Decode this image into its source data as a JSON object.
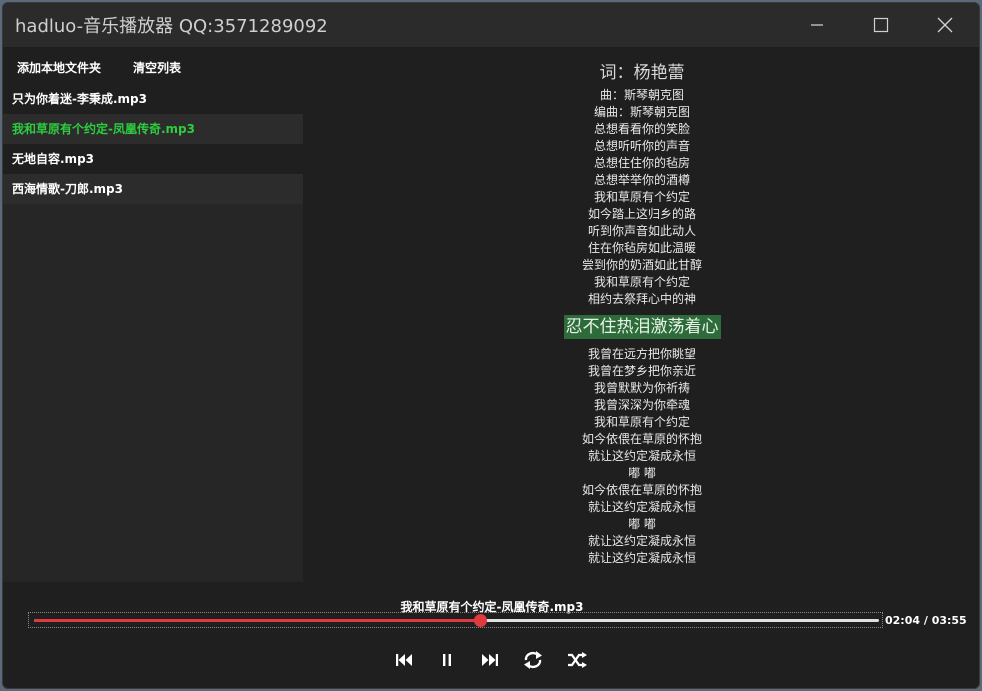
{
  "window": {
    "title": "hadluo-音乐播放器 QQ:3571289092",
    "buttons": [
      "minimize-icon",
      "maximize-icon",
      "close-icon"
    ]
  },
  "toolbar": {
    "add_folder_label": "添加本地文件夹",
    "clear_list_label": "清空列表"
  },
  "playlist": {
    "items": [
      {
        "label": "只为你着迷-李秉成.mp3",
        "active": false
      },
      {
        "label": "我和草原有个约定-凤凰传奇.mp3",
        "active": true
      },
      {
        "label": "无地自容.mp3",
        "active": false
      },
      {
        "label": "西海情歌-刀郎.mp3",
        "active": false
      }
    ],
    "active_color": "#2ecc40"
  },
  "lyrics": {
    "lines": [
      "词：杨艳蕾",
      "曲：斯琴朝克图",
      "编曲：斯琴朝克图",
      "总想看看你的笑脸",
      "总想听听你的声音",
      "总想住住你的毡房",
      "总想举举你的酒樽",
      "我和草原有个约定",
      "如今踏上这归乡的路",
      "听到你声音如此动人",
      "住在你毡房如此温暖",
      "尝到你的奶酒如此甘醇",
      "我和草原有个约定",
      "相约去祭拜心中的神",
      "忍不住热泪激荡着心",
      "我曾在远方把你眺望",
      "我曾在梦乡把你亲近",
      "我曾默默为你祈祷",
      "我曾深深为你牵魂",
      "我和草原有个约定",
      "如今依偎在草原的怀抱",
      "就让这约定凝成永恒",
      "嘟  嘟",
      "如今依偎在草原的怀抱",
      "就让这约定凝成永恒",
      "嘟  嘟",
      "就让这约定凝成永恒",
      "就让这约定凝成永恒"
    ],
    "current_index": 14,
    "highlight_color": "#2e6b3b"
  },
  "player": {
    "now_playing": "我和草原有个约定-凤凰传奇.mp3",
    "time_display": "02:04 / 03:55",
    "progress": 0.528,
    "progress_color": "#e0393e",
    "controls": [
      "previous-icon",
      "pause-icon",
      "next-icon",
      "repeat-icon",
      "shuffle-icon"
    ]
  }
}
